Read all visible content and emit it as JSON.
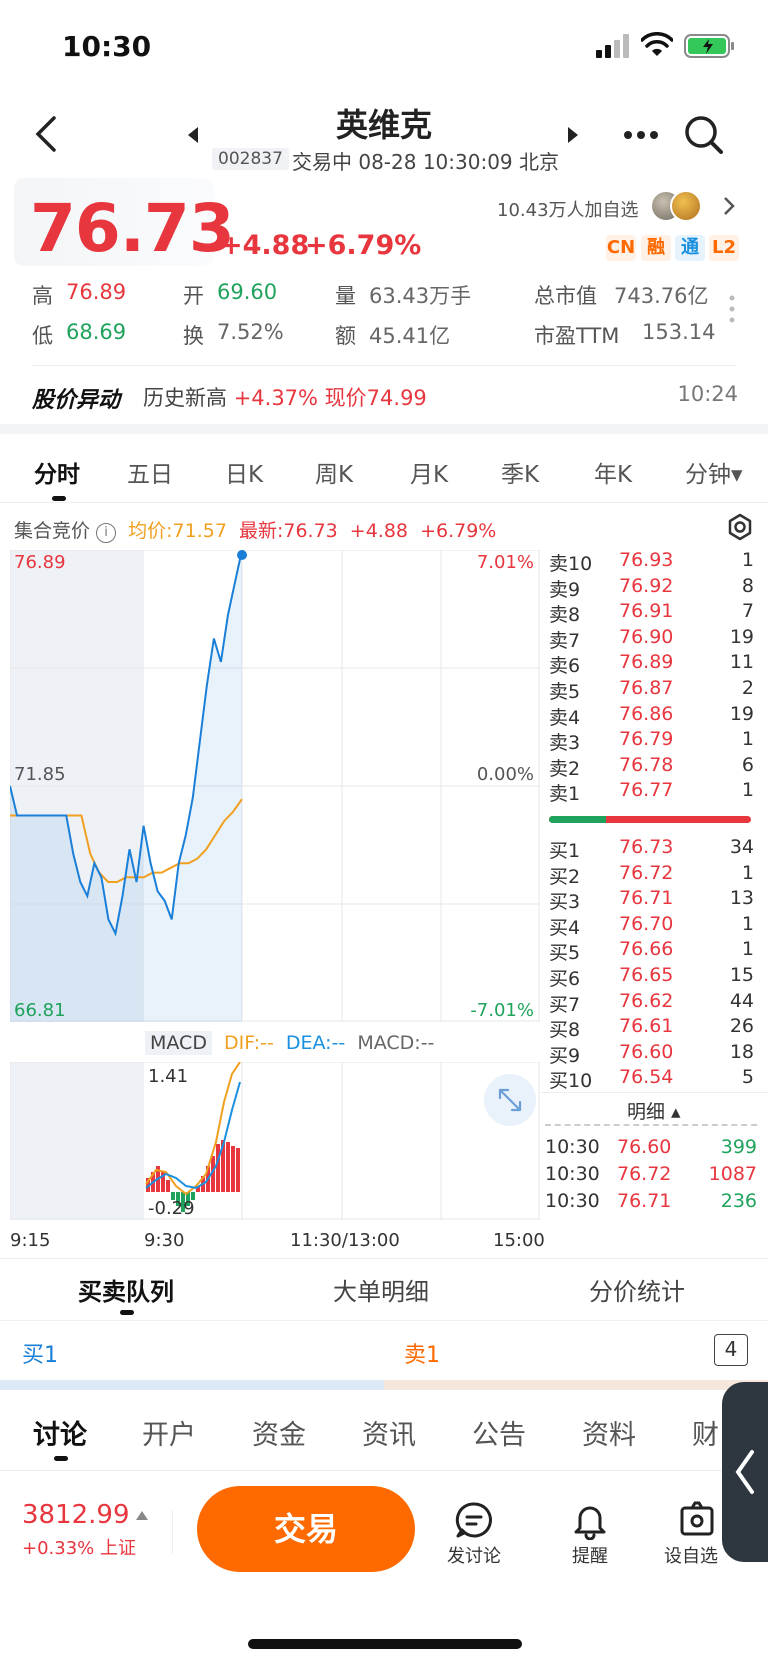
{
  "status_bar": {
    "time": "10:30"
  },
  "header": {
    "name": "英维克",
    "code": "002837",
    "status": "交易中 08-28 10:30:09 北京"
  },
  "quote": {
    "price": "76.73",
    "change": "+4.88",
    "change_pct": "+6.79%",
    "watch_count": "10.43万人加自选",
    "badges": [
      "CN",
      "融",
      "通",
      "L2"
    ],
    "stats": [
      {
        "label": "高",
        "value": "76.89",
        "color": "red"
      },
      {
        "label": "开",
        "value": "69.60",
        "color": "green"
      },
      {
        "label": "量",
        "value": "63.43万手",
        "color": "gray"
      },
      {
        "label": "总市值",
        "value": "743.76亿",
        "color": "gray"
      },
      {
        "label": "低",
        "value": "68.69",
        "color": "green"
      },
      {
        "label": "换",
        "value": "7.52%",
        "color": "gray"
      },
      {
        "label": "额",
        "value": "45.41亿",
        "color": "gray"
      },
      {
        "label": "市盈TTM",
        "value": "153.14",
        "color": "gray"
      }
    ]
  },
  "alert": {
    "title": "股价异动",
    "text_prefix": "历史新高 ",
    "text_hl": "+4.37% 现价74.99",
    "time": "10:24"
  },
  "period_tabs": [
    "分时",
    "五日",
    "日K",
    "周K",
    "月K",
    "季K",
    "年K",
    "分钟▾"
  ],
  "chart_info": {
    "auction": "集合竞价",
    "avg": "均价:71.57",
    "latest": "最新:76.73",
    "chg": "+4.88",
    "pct": "+6.79%"
  },
  "chart_data": {
    "type": "line",
    "y_max": "76.89",
    "y_mid": "71.85",
    "y_min": "66.81",
    "pct_max": "7.01%",
    "pct_mid": "0.00%",
    "pct_min": "-7.01%",
    "x_ticks": [
      "9:15",
      "9:30",
      "11:30/13:00",
      "15:00"
    ],
    "price_series": [
      71.85,
      71.22,
      71.22,
      71.22,
      71.22,
      71.22,
      71.22,
      71.22,
      71.22,
      70.4,
      69.8,
      69.5,
      70.2,
      69.9,
      69.0,
      68.7,
      69.5,
      70.5,
      69.8,
      71.0,
      70.2,
      69.6,
      69.4,
      69.0,
      70.2,
      70.8,
      71.6,
      72.8,
      74.0,
      75.0,
      74.5,
      75.5,
      76.2,
      76.89
    ],
    "avg_series": [
      71.22,
      71.22,
      71.22,
      71.22,
      71.22,
      71.22,
      71.22,
      71.22,
      71.22,
      70.4,
      70.0,
      69.8,
      69.8,
      69.9,
      69.9,
      69.9,
      70.0,
      70.0,
      70.1,
      70.2,
      70.2,
      70.3,
      70.5,
      70.8,
      71.1,
      71.3,
      71.57
    ],
    "macd": {
      "label": "MACD",
      "dif": "DIF:--",
      "dea": "DEA:--",
      "val": "MACD:--",
      "top": "1.41",
      "bottom": "-0.29"
    }
  },
  "order_book": {
    "asks": [
      {
        "label": "卖10",
        "price": "76.93",
        "vol": "1"
      },
      {
        "label": "卖9",
        "price": "76.92",
        "vol": "8"
      },
      {
        "label": "卖8",
        "price": "76.91",
        "vol": "7"
      },
      {
        "label": "卖7",
        "price": "76.90",
        "vol": "19"
      },
      {
        "label": "卖6",
        "price": "76.89",
        "vol": "11"
      },
      {
        "label": "卖5",
        "price": "76.87",
        "vol": "2"
      },
      {
        "label": "卖4",
        "price": "76.86",
        "vol": "19"
      },
      {
        "label": "卖3",
        "price": "76.79",
        "vol": "1"
      },
      {
        "label": "卖2",
        "price": "76.78",
        "vol": "6"
      },
      {
        "label": "卖1",
        "price": "76.77",
        "vol": "1"
      }
    ],
    "bids": [
      {
        "label": "买1",
        "price": "76.73",
        "vol": "34"
      },
      {
        "label": "买2",
        "price": "76.72",
        "vol": "1"
      },
      {
        "label": "买3",
        "price": "76.71",
        "vol": "13"
      },
      {
        "label": "买4",
        "price": "76.70",
        "vol": "1"
      },
      {
        "label": "买5",
        "price": "76.66",
        "vol": "1"
      },
      {
        "label": "买6",
        "price": "76.65",
        "vol": "15"
      },
      {
        "label": "买7",
        "price": "76.62",
        "vol": "44"
      },
      {
        "label": "买8",
        "price": "76.61",
        "vol": "26"
      },
      {
        "label": "买9",
        "price": "76.60",
        "vol": "18"
      },
      {
        "label": "买10",
        "price": "76.54",
        "vol": "5"
      }
    ],
    "buy_ratio": 0.28,
    "detail_label": "明细 ▴",
    "ticks": [
      {
        "time": "10:30",
        "price": "76.60",
        "vol": "399",
        "color": "green"
      },
      {
        "time": "10:30",
        "price": "76.72",
        "vol": "1087",
        "color": "red"
      },
      {
        "time": "10:30",
        "price": "76.71",
        "vol": "236",
        "color": "green"
      }
    ]
  },
  "sub_tabs": [
    "买卖队列",
    "大单明细",
    "分价统计"
  ],
  "queue": {
    "buy": "买1",
    "sell": "卖1",
    "count": "4"
  },
  "bottom_tabs": [
    "讨论",
    "开户",
    "资金",
    "资讯",
    "公告",
    "资料",
    "财"
  ],
  "footer": {
    "index_value": "3812.99",
    "index_change": "+0.33%",
    "index_name": "上证",
    "trade_btn": "交易",
    "tools": [
      "发讨论",
      "提醒",
      "设自选"
    ]
  },
  "colors": {
    "up": "#e8363e",
    "down": "#1fa35c",
    "accent": "#ff6a00",
    "line": "#1a7fd8",
    "avg": "#f0a020"
  }
}
